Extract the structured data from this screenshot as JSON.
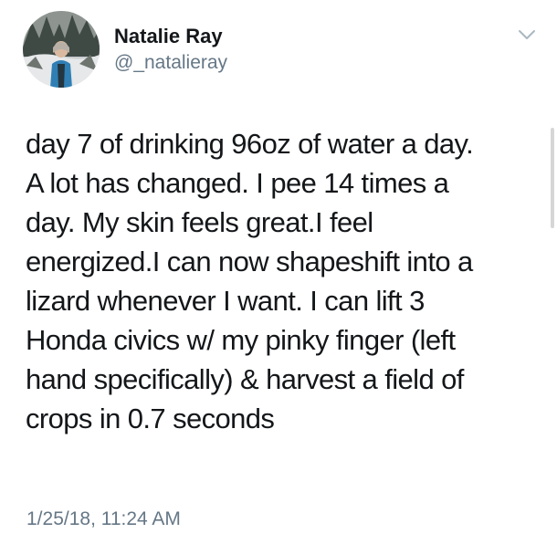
{
  "tweet": {
    "author": {
      "display_name": "Natalie Ray",
      "username": "@_natalieray"
    },
    "text": "day 7 of drinking 96oz of water a day.\nA lot has changed. I pee 14 times a\nday. My skin feels great.I feel\nenergized.I can now shapeshift into a\nlizard whenever I want. I can lift 3\nHonda civics w/ my pinky finger (left\nhand specifically) & harvest a field of\ncrops in 0.7 seconds",
    "timestamp": "1/25/18, 11:24 AM"
  },
  "icons": {
    "menu": "chevron-down-icon"
  },
  "colors": {
    "text_primary": "#14171a",
    "text_secondary": "#657786"
  }
}
